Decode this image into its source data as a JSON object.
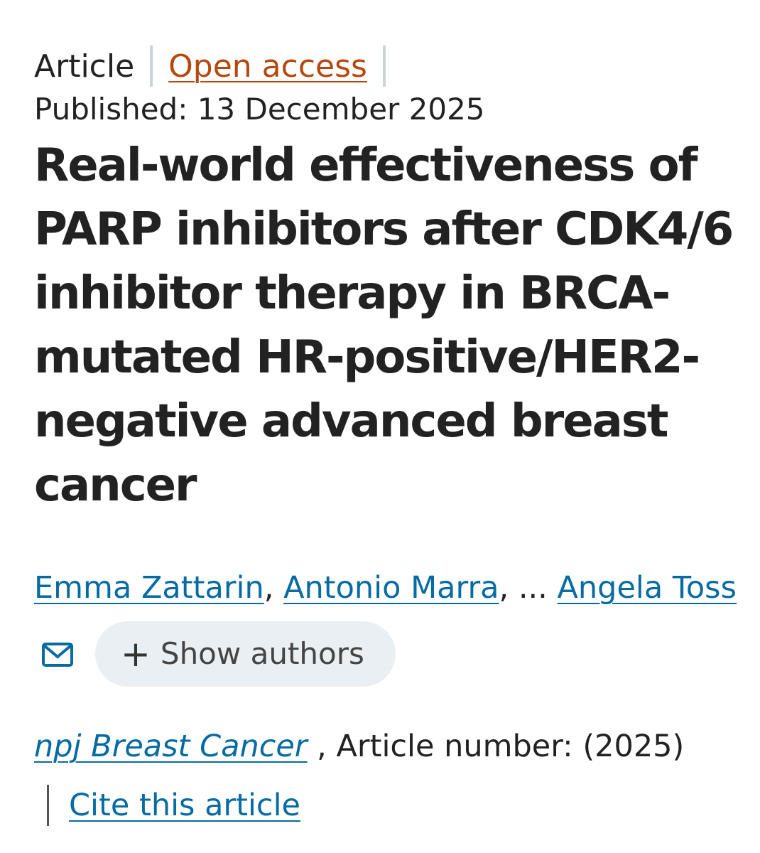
{
  "meta": {
    "article_type": "Article",
    "open_access_label": "Open access",
    "published": "Published: 13 December 2025"
  },
  "title": "Real-world effectiveness of PARP inhibitors after CDK4/6 inhibitor therapy in BRCA-mutated HR-positive/HER2-negative advanced breast cancer",
  "authors": {
    "list": [
      "Emma Zattarin",
      "Antonio Marra",
      "Angela Toss"
    ],
    "comma": ",",
    "ellipsis": "...",
    "show_authors_label": "Show authors",
    "plus_symbol": "+",
    "mail_icon": "envelope-icon"
  },
  "citation": {
    "journal": "npj Breast Cancer",
    "article_number_text": ", Article number:  (2025)",
    "cite_label": "Cite this article"
  },
  "colors": {
    "link": "#066aa3",
    "open_access": "#b5470f",
    "text": "#222222",
    "button_bg": "#eaeff3"
  }
}
